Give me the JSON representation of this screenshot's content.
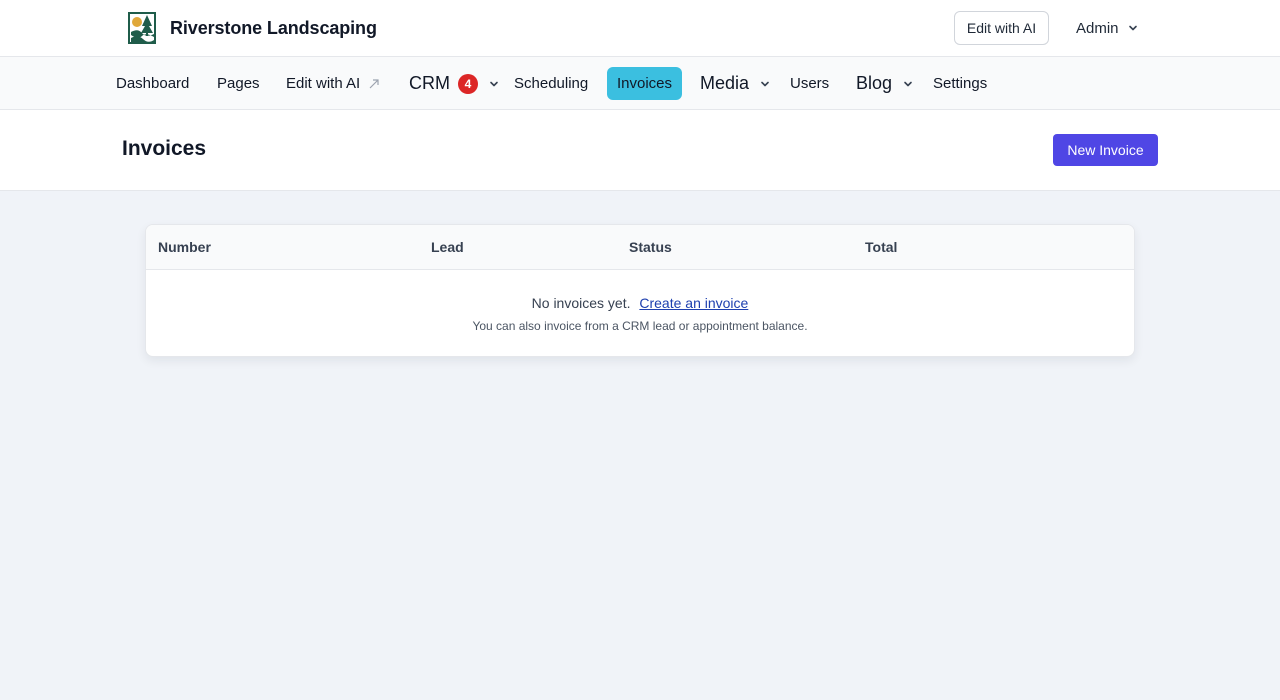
{
  "brand": {
    "name": "Riverstone Landscaping",
    "logo_icon": "tree-river-logo"
  },
  "topbar": {
    "edit_ai_label": "Edit with AI",
    "admin_label": "Admin"
  },
  "nav": {
    "dashboard": "Dashboard",
    "pages": "Pages",
    "edit_ai": "Edit with AI",
    "crm": "CRM",
    "crm_badge": "4",
    "scheduling": "Scheduling",
    "invoices": "Invoices",
    "media": "Media",
    "users": "Users",
    "blog": "Blog",
    "settings": "Settings",
    "active": "Invoices"
  },
  "page": {
    "title": "Invoices",
    "new_button": "New Invoice"
  },
  "table": {
    "columns": [
      "Number",
      "Lead",
      "Status",
      "Total"
    ],
    "rows": [],
    "empty_text": "No invoices yet.",
    "empty_link": "Create an invoice",
    "empty_hint": "You can also invoice from a CRM lead or appointment balance."
  },
  "colors": {
    "accent": "#4f46e5",
    "active_nav": "#3bbfe0",
    "badge": "#dc2626",
    "link": "#1e40af"
  }
}
